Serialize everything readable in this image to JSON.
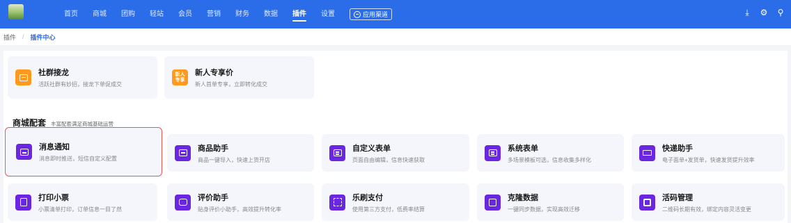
{
  "nav": {
    "items": [
      {
        "label": "首页",
        "active": false
      },
      {
        "label": "商城",
        "active": false
      },
      {
        "label": "团购",
        "active": false
      },
      {
        "label": "轻站",
        "active": false
      },
      {
        "label": "会员",
        "active": false
      },
      {
        "label": "营销",
        "active": false
      },
      {
        "label": "财务",
        "active": false
      },
      {
        "label": "数据",
        "active": false
      },
      {
        "label": "插件",
        "active": true
      },
      {
        "label": "设置",
        "active": false
      }
    ],
    "channel_button": "应用渠道",
    "tools": {
      "download": "⤓",
      "settings": "⚙",
      "user": "⚲"
    }
  },
  "breadcrumb": [
    "插件",
    "插件中心"
  ],
  "cards_top": [
    {
      "title": "社群接龙",
      "desc": "活跃社群有妙招，接龙下单促成交",
      "icon": "group-chain-icon",
      "color": "#ff9a1f"
    },
    {
      "title": "新人专享价",
      "desc": "新人首单专享，立即转化成交",
      "icon": "new-user-price-icon",
      "color": "#ff9a1f",
      "badge": "新人\n专享"
    }
  ],
  "section": {
    "title": "商城配套",
    "subtitle": "丰富配套满足商城基础运营"
  },
  "cards_grid": [
    {
      "title": "消息通知",
      "desc": "消息即时推送，短信自定义配置",
      "icon": "message-notify-icon",
      "highlight": true
    },
    {
      "title": "商品助手",
      "desc": "商品一键导入，快速上货开店",
      "icon": "product-assistant-icon"
    },
    {
      "title": "自定义表单",
      "desc": "页面自由编辑，信息快速获取",
      "icon": "custom-form-icon"
    },
    {
      "title": "系统表单",
      "desc": "多场景模板可选，信息收集多样化",
      "icon": "system-form-icon"
    },
    {
      "title": "快递助手",
      "desc": "电子面单+发货单，快速发货提升效率",
      "icon": "express-truck-icon"
    },
    {
      "title": "打印小票",
      "desc": "小票清单打印，订单信息一目了然",
      "icon": "print-receipt-icon"
    },
    {
      "title": "评价助手",
      "desc": "贴身评价小助手，高效提升转化率",
      "icon": "review-assistant-icon"
    },
    {
      "title": "乐刷支付",
      "desc": "使用第三方支付，低费率结算",
      "icon": "leshua-pay-icon"
    },
    {
      "title": "克隆数据",
      "desc": "一键同步数据，实现高效迁移",
      "icon": "clone-data-icon"
    },
    {
      "title": "活码管理",
      "desc": "二维码长期有效，绑定内容灵活变更",
      "icon": "live-qrcode-icon"
    }
  ]
}
